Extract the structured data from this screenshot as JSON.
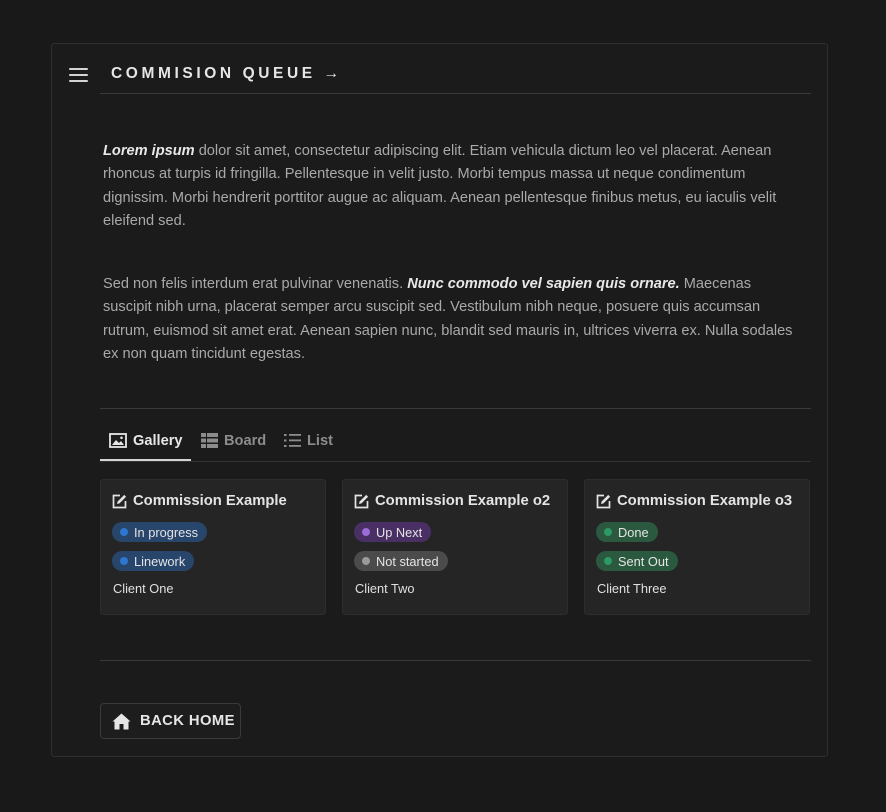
{
  "header": {
    "title": "COMMISION QUEUE →"
  },
  "intro": {
    "p1_bold": "Lorem ipsum",
    "p1_rest": " dolor sit amet, consectetur adipiscing elit. Etiam vehicula dictum leo vel placerat. Aenean rhoncus at turpis id fringilla. Pellentesque in velit justo. Morbi tempus massa ut neque condimentum dignissim. Morbi hendrerit porttitor augue ac aliquam. Aenean pellentesque finibus metus, eu iaculis velit eleifend sed.",
    "p2_start": "Sed non felis interdum erat pulvinar venenatis. ",
    "p2_bold": "Nunc commodo vel sapien quis ornare.",
    "p2_rest": " Maecenas suscipit nibh urna, placerat semper arcu suscipit sed. Vestibulum nibh neque, posuere quis accumsan rutrum, euismod sit amet erat. Aenean sapien nunc, blandit sed mauris in, ultrices viverra ex. Nulla sodales ex non quam tincidunt egestas."
  },
  "tabs": [
    {
      "label": "Gallery",
      "icon": "image-icon",
      "active": true
    },
    {
      "label": "Board",
      "icon": "board-icon",
      "active": false
    },
    {
      "label": "List",
      "icon": "list-icon",
      "active": false
    }
  ],
  "cards": [
    {
      "title": "Commission Example",
      "status": {
        "label": "In progress",
        "color": "#2e77d0",
        "bg": "#28456c"
      },
      "tag": {
        "label": "Linework",
        "color": "#2e77d0",
        "bg": "#28456c"
      },
      "client": "Client One"
    },
    {
      "title": "Commission Example o2",
      "status": {
        "label": "Up Next",
        "color": "#9a6dd7",
        "bg": "#492f64"
      },
      "tag": {
        "label": "Not started",
        "color": "#9b9b9b",
        "bg": "#4b4b4b"
      },
      "client": "Client Two"
    },
    {
      "title": "Commission Example o3",
      "status": {
        "label": "Done",
        "color": "#2d9964",
        "bg": "#2b593f"
      },
      "tag": {
        "label": "Sent Out",
        "color": "#2d9964",
        "bg": "#2b593f"
      },
      "client": "Client Three"
    }
  ],
  "footer": {
    "back_label": "BACK HOME"
  }
}
